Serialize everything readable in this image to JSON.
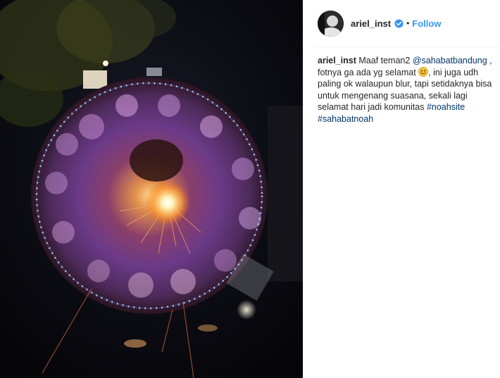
{
  "header": {
    "username": "ariel_inst",
    "separator": "•",
    "follow_label": "Follow"
  },
  "caption": {
    "username": "ariel_inst",
    "text_1": "Maaf teman2",
    "mention": "@sahabatbandung",
    "text_2": ",",
    "text_3": "fotnya ga ada yg selamat",
    "emoji": "smiling-face",
    "text_4": ", ini juga udh paling ok walaupun blur, tapi setidaknya bisa untuk mengenang suasana, sekali lagi selamat hari jadi komunitas",
    "hashtag_1": "#noahsite",
    "hashtag_2": "#sahabatnoah"
  },
  "icons": {
    "verified": "verified-badge-icon",
    "emoji": "smiling-face-emoji-icon"
  },
  "colors": {
    "follow": "#3897f0",
    "link": "#003569",
    "verified_badge": "#3897f0",
    "text": "#262626"
  }
}
